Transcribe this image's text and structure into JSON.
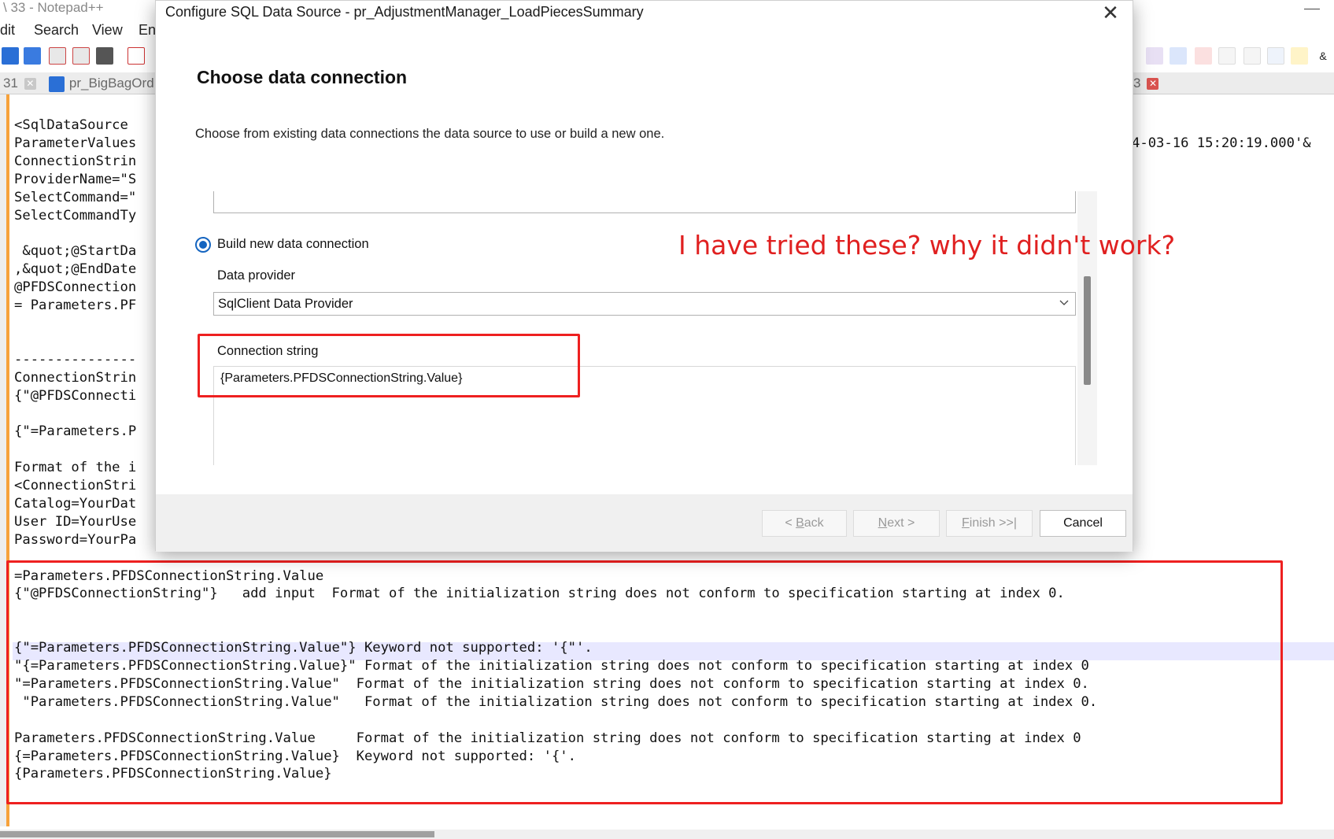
{
  "notepad": {
    "title_fragment": "\\ 33 - Notepad++",
    "menu": {
      "edit": "dit",
      "search": "Search",
      "view": "View",
      "encoding": "En"
    },
    "tabs": {
      "left_number": "31",
      "second_tab": "pr_BigBagOrd",
      "right_fragment": "3"
    },
    "editor_lines": [
      "<SqlDataSource",
      "ParameterValues",
      "ConnectionStrin",
      "ProviderName=\"S",
      "SelectCommand=\"",
      "SelectCommandTy",
      "",
      " &quot;@StartDa",
      ",&quot;@EndDate",
      "@PFDSConnection",
      "= Parameters.PF",
      "",
      "",
      "---------------",
      "ConnectionStrin",
      "{\"@PFDSConnecti",
      "",
      "{\"=Parameters.P",
      "",
      "Format of the i",
      "<ConnectionStri",
      "Catalog=YourDat",
      "User ID=YourUse",
      "Password=YourPa",
      "",
      "=Parameters.PFDSConnectionString.Value",
      "{\"@PFDSConnectionString\"}   add input  Format of the initialization string does not conform to specification starting at index 0.",
      "",
      "",
      "{\"=Parameters.PFDSConnectionString.Value\"} Keyword not supported: '{\"'.",
      "\"{=Parameters.PFDSConnectionString.Value}\" Format of the initialization string does not conform to specification starting at index 0",
      "\"=Parameters.PFDSConnectionString.Value\"  Format of the initialization string does not conform to specification starting at index 0.",
      " \"Parameters.PFDSConnectionString.Value\"   Format of the initialization string does not conform to specification starting at index 0.",
      "",
      "Parameters.PFDSConnectionString.Value     Format of the initialization string does not conform to specification starting at index 0",
      "{=Parameters.PFDSConnectionString.Value}  Keyword not supported: '{'.",
      "{Parameters.PFDSConnectionString.Value}"
    ],
    "right_fragment": "4-03-16 15:20:19.000'&"
  },
  "dialog": {
    "title": "Configure SQL Data Source - pr_AdjustmentManager_LoadPiecesSummary",
    "heading": "Choose data connection",
    "subtitle": "Choose from existing data connections the data source to use or build a new one.",
    "radio_label": "Build new data connection",
    "data_provider_label": "Data provider",
    "data_provider_value": "SqlClient Data Provider",
    "connection_string_label": "Connection string",
    "connection_string_value": "{Parameters.PFDSConnectionString.Value}",
    "buttons": {
      "back_prefix": "< ",
      "back_key": "B",
      "back_rest": "ack",
      "next_key": "N",
      "next_rest": "ext >",
      "finish_key": "F",
      "finish_rest": "inish >>|",
      "cancel": "Cancel"
    }
  },
  "annotation": "I have tried these? why it didn't work?",
  "colors": {
    "accent": "#1565c0",
    "annotation_red": "#e02020",
    "gutter_orange": "#f7a23b"
  }
}
